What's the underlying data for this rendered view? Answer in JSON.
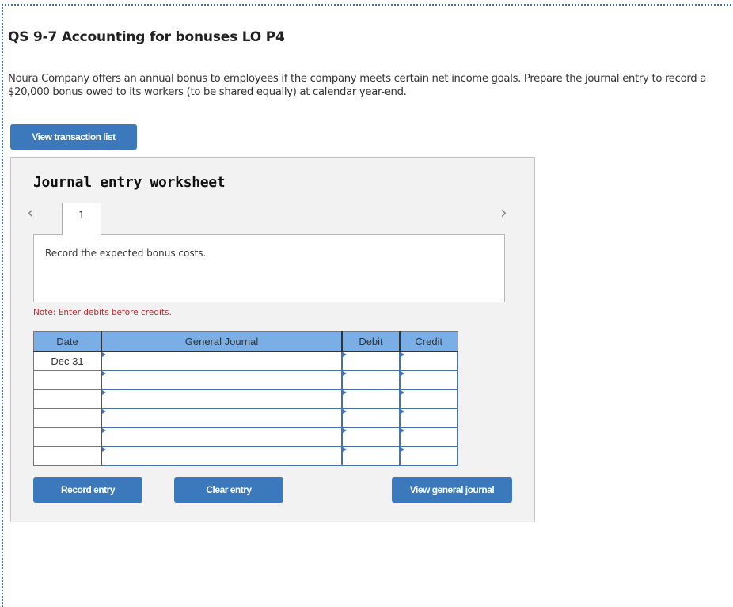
{
  "question": {
    "title": "QS 9-7 Accounting for bonuses LO P4",
    "description": "Noura Company offers an annual bonus to employees if the company meets certain net income goals. Prepare the journal entry to record a $20,000 bonus owed to its workers (to be shared equally) at calendar year-end."
  },
  "buttons": {
    "view_transaction_list": "View transaction list",
    "record_entry": "Record entry",
    "clear_entry": "Clear entry",
    "view_general_journal": "View general journal"
  },
  "worksheet": {
    "title": "Journal entry worksheet",
    "prev_icon": "chevron-left-icon",
    "next_icon": "chevron-right-icon",
    "prev_glyph": "‹",
    "next_glyph": "›",
    "tabs": [
      {
        "label": "1",
        "active": true
      }
    ],
    "instruction": "Record the expected bonus costs.",
    "note": "Note: Enter debits before credits."
  },
  "journal": {
    "headers": {
      "date": "Date",
      "general_journal": "General Journal",
      "debit": "Debit",
      "credit": "Credit"
    },
    "rows": [
      {
        "date": "Dec 31",
        "account": "",
        "debit": "",
        "credit": ""
      },
      {
        "date": "",
        "account": "",
        "debit": "",
        "credit": ""
      },
      {
        "date": "",
        "account": "",
        "debit": "",
        "credit": ""
      },
      {
        "date": "",
        "account": "",
        "debit": "",
        "credit": ""
      },
      {
        "date": "",
        "account": "",
        "debit": "",
        "credit": ""
      },
      {
        "date": "",
        "account": "",
        "debit": "",
        "credit": ""
      }
    ]
  },
  "colors": {
    "accent": "#3c78bc",
    "header_bg": "#7aaee4",
    "note_red": "#c0272d",
    "panel_bg": "#f2f2f2"
  }
}
